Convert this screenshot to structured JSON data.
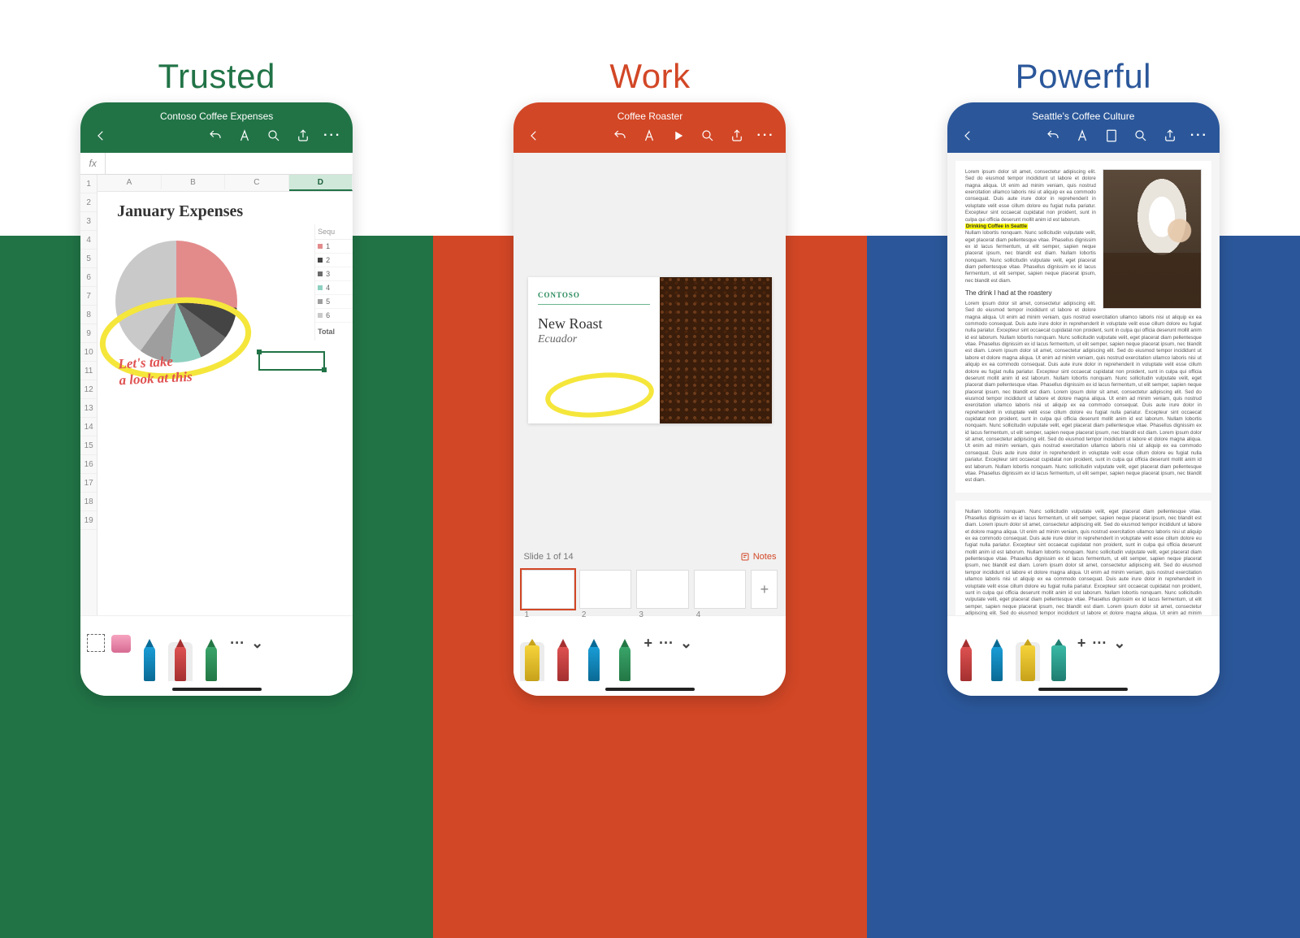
{
  "panels": {
    "excel": {
      "title": "Trusted",
      "color": "#217346",
      "doc_title": "Contoso Coffee Expenses"
    },
    "ppt": {
      "title": "Work",
      "color": "#d24726",
      "doc_title": "Coffee Roaster"
    },
    "word": {
      "title": "Powerful",
      "color": "#2b579a",
      "doc_title": "Seattle's Coffee Culture"
    }
  },
  "excel": {
    "fx_label": "fx",
    "columns": [
      "A",
      "B",
      "C",
      "D"
    ],
    "col_selected": "D",
    "rows": [
      "1",
      "2",
      "3",
      "4",
      "5",
      "6",
      "7",
      "8",
      "9",
      "10",
      "11",
      "12",
      "13",
      "14",
      "15",
      "16",
      "17",
      "18",
      "19"
    ],
    "chart_title": "January Expenses",
    "legend_header": "Sequ",
    "legend": [
      {
        "label": "1",
        "color": "#e38b8b"
      },
      {
        "label": "2",
        "color": "#444444"
      },
      {
        "label": "3",
        "color": "#6b6b6b"
      },
      {
        "label": "4",
        "color": "#8fd1c1"
      },
      {
        "label": "5",
        "color": "#9e9e9e"
      },
      {
        "label": "6",
        "color": "#c9c9c9"
      }
    ],
    "legend_total": "Total",
    "annotation": "Let's take\na look at this"
  },
  "ppt": {
    "brand": "CONTOSO",
    "slide_title": "New Roast",
    "slide_sub": "Ecuador",
    "slide_counter": "Slide 1 of 14",
    "notes_label": "Notes",
    "thumbs": [
      "1",
      "2",
      "3",
      "4"
    ]
  },
  "word": {
    "highlight": "Drinking Coffee in Seattle",
    "subhead": "The drink I had at the roastery",
    "para": "Lorem ipsum dolor sit amet, consectetur adipiscing elit. Sed do eiusmod tempor incididunt ut labore et dolore magna aliqua. Ut enim ad minim veniam, quis nostrud exercitation ullamco laboris nisi ut aliquip ex ea commodo consequat. Duis aute irure dolor in reprehenderit in voluptate velit esse cillum dolore eu fugiat nulla pariatur. Excepteur sint occaecat cupidatat non proident, sunt in culpa qui officia deserunt mollit anim id est laborum. ",
    "para2": "Nullam lobortis nonquam. Nunc sollicitudin vulputate velit, eget placerat diam pellentesque vitae. Phasellus dignissim ex id lacus fermentum, ut elit semper, sapien neque placerat ipsum, nec blandit est diam. "
  },
  "chart_data": {
    "type": "pie",
    "title": "January Expenses",
    "series": [
      {
        "name": "1",
        "value": 27,
        "color": "#e38b8b"
      },
      {
        "name": "2",
        "value": 8,
        "color": "#444444"
      },
      {
        "name": "3",
        "value": 8,
        "color": "#6b6b6b"
      },
      {
        "name": "4",
        "value": 8,
        "color": "#8fd1c1"
      },
      {
        "name": "5",
        "value": 8,
        "color": "#9e9e9e"
      },
      {
        "name": "6",
        "value": 41,
        "color": "#c9c9c9"
      }
    ]
  }
}
